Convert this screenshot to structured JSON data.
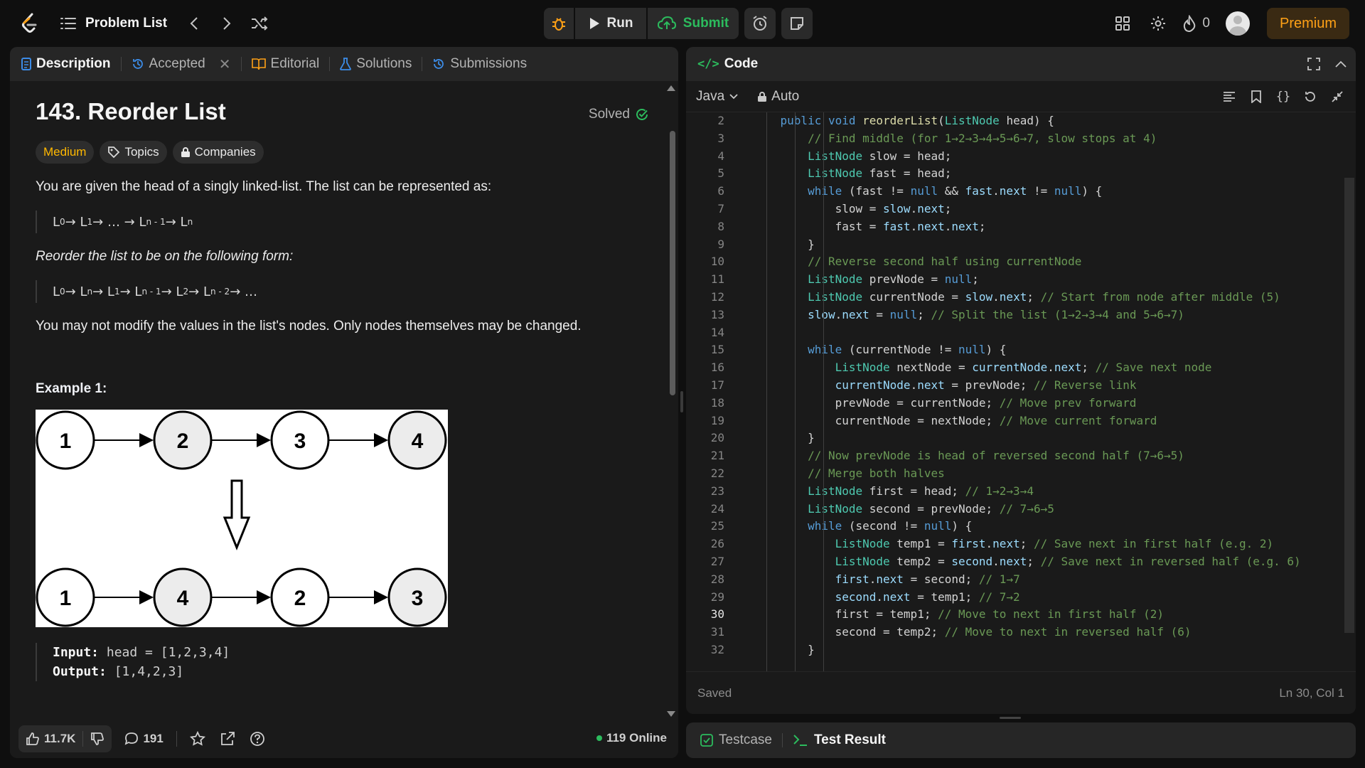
{
  "topbar": {
    "problem_list": "Problem List",
    "run": "Run",
    "submit": "Submit",
    "streak": "0",
    "premium": "Premium"
  },
  "left_panel": {
    "tabs": [
      {
        "label": "Description"
      },
      {
        "label": "Accepted"
      },
      {
        "label": "Editorial"
      },
      {
        "label": "Solutions"
      },
      {
        "label": "Submissions"
      }
    ],
    "title": "143. Reorder List",
    "solved": "Solved",
    "chips": {
      "difficulty": "Medium",
      "topics": "Topics",
      "companies": "Companies"
    },
    "p1": "You are given the head of a singly linked-list. The list can be represented as:",
    "formula1": [
      "L",
      "0",
      " → L",
      "1",
      " → … → L",
      "n - 1",
      " → L",
      "n"
    ],
    "p2": "Reorder the list to be on the following form:",
    "formula2": [
      "L",
      "0",
      " → L",
      "n",
      " → L",
      "1",
      " → L",
      "n - 1",
      " → L",
      "2",
      " → L",
      "n - 2",
      " → …"
    ],
    "p3": "You may not modify the values in the list's nodes. Only nodes themselves may be changed.",
    "example_title": "Example 1:",
    "example_top": [
      "1",
      "2",
      "3",
      "4"
    ],
    "example_bottom": [
      "1",
      "4",
      "2",
      "3"
    ],
    "input_label": "Input:",
    "input_value": " head = [1,2,3,4]",
    "output_label": "Output:",
    "output_value": " [1,4,2,3]",
    "likes": "11.7K",
    "comments": "191",
    "online": "119 Online"
  },
  "code_panel": {
    "title": "Code",
    "language": "Java",
    "mode": "Auto",
    "status": "Saved",
    "cursor": "Ln 30, Col 1",
    "current_line": 30,
    "lines": [
      {
        "n": 2,
        "text": "    public void reorderList(ListNode head) {"
      },
      {
        "n": 3,
        "text": "        // Find middle (for 1→2→3→4→5→6→7, slow stops at 4)"
      },
      {
        "n": 4,
        "text": "        ListNode slow = head;"
      },
      {
        "n": 5,
        "text": "        ListNode fast = head;"
      },
      {
        "n": 6,
        "text": "        while (fast != null && fast.next != null) {"
      },
      {
        "n": 7,
        "text": "            slow = slow.next;"
      },
      {
        "n": 8,
        "text": "            fast = fast.next.next;"
      },
      {
        "n": 9,
        "text": "        }"
      },
      {
        "n": 10,
        "text": "        // Reverse second half using currentNode"
      },
      {
        "n": 11,
        "text": "        ListNode prevNode = null;"
      },
      {
        "n": 12,
        "text": "        ListNode currentNode = slow.next; // Start from node after middle (5)"
      },
      {
        "n": 13,
        "text": "        slow.next = null; // Split the list (1→2→3→4 and 5→6→7)"
      },
      {
        "n": 14,
        "text": ""
      },
      {
        "n": 15,
        "text": "        while (currentNode != null) {"
      },
      {
        "n": 16,
        "text": "            ListNode nextNode = currentNode.next; // Save next node"
      },
      {
        "n": 17,
        "text": "            currentNode.next = prevNode; // Reverse link"
      },
      {
        "n": 18,
        "text": "            prevNode = currentNode; // Move prev forward"
      },
      {
        "n": 19,
        "text": "            currentNode = nextNode; // Move current forward"
      },
      {
        "n": 20,
        "text": "        }"
      },
      {
        "n": 21,
        "text": "        // Now prevNode is head of reversed second half (7→6→5)"
      },
      {
        "n": 22,
        "text": "        // Merge both halves"
      },
      {
        "n": 23,
        "text": "        ListNode first = head; // 1→2→3→4"
      },
      {
        "n": 24,
        "text": "        ListNode second = prevNode; // 7→6→5"
      },
      {
        "n": 25,
        "text": "        while (second != null) {"
      },
      {
        "n": 26,
        "text": "            ListNode temp1 = first.next; // Save next in first half (e.g. 2)"
      },
      {
        "n": 27,
        "text": "            ListNode temp2 = second.next; // Save next in reversed half (e.g. 6)"
      },
      {
        "n": 28,
        "text": "            first.next = second; // 1→7"
      },
      {
        "n": 29,
        "text": "            second.next = temp1; // 7→2"
      },
      {
        "n": 30,
        "text": "            first = temp1; // Move to next in first half (2)"
      },
      {
        "n": 31,
        "text": "            second = temp2; // Move to next in reversed half (6)"
      },
      {
        "n": 32,
        "text": "        }"
      }
    ]
  },
  "test_bar": {
    "testcase": "Testcase",
    "result": "Test Result"
  },
  "colors": {
    "accent_orange": "#ffa116",
    "green": "#2cbb5d",
    "medium": "#ffb800"
  }
}
